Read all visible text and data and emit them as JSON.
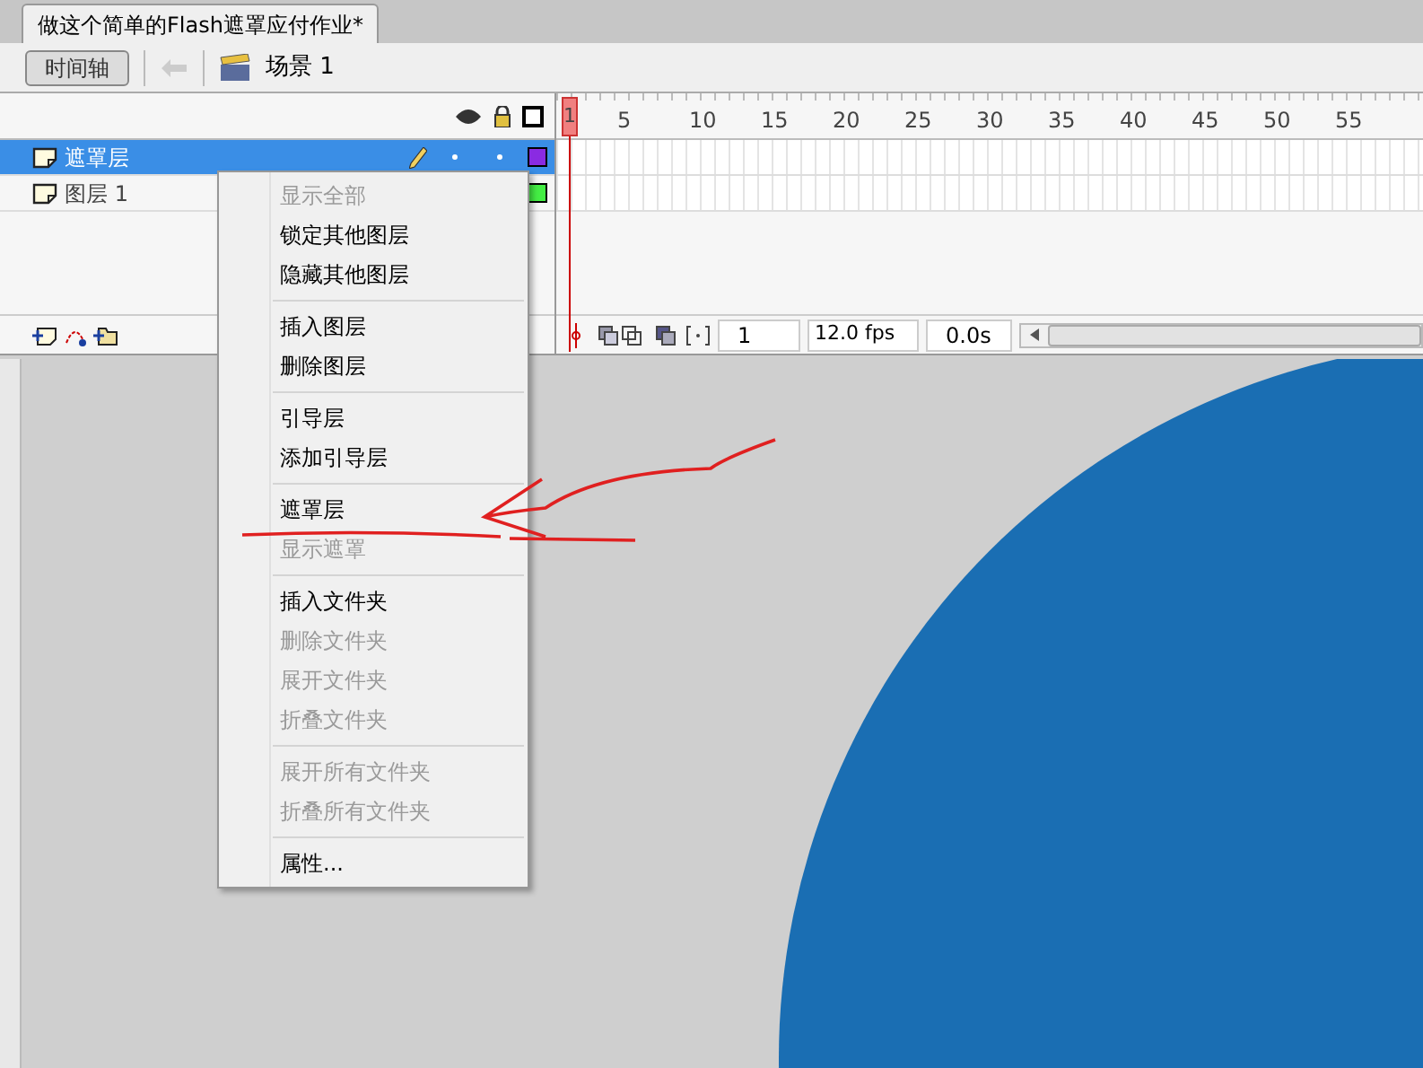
{
  "document_tab": {
    "title": "做这个简单的Flash遮罩应付作业*"
  },
  "toolbar": {
    "timeline_button": "时间轴",
    "scene": "场景 1"
  },
  "timeline": {
    "frame_numbers": [
      "1",
      "5",
      "10",
      "15",
      "20",
      "25",
      "30",
      "35",
      "40",
      "45",
      "50",
      "55"
    ],
    "layers": [
      {
        "name": "遮罩层",
        "selected": true,
        "color": "#8a2be2"
      },
      {
        "name": "图层 1",
        "selected": false,
        "color": "#44ee44"
      }
    ],
    "current_frame": "1",
    "frame_rate": "12.0 fps",
    "elapsed_time": "0.0s"
  },
  "context_menu": [
    {
      "kind": "item",
      "label": "显示全部",
      "disabled": true
    },
    {
      "kind": "item",
      "label": "锁定其他图层",
      "disabled": false
    },
    {
      "kind": "item",
      "label": "隐藏其他图层",
      "disabled": false
    },
    {
      "kind": "separator"
    },
    {
      "kind": "item",
      "label": "插入图层",
      "disabled": false
    },
    {
      "kind": "item",
      "label": "删除图层",
      "disabled": false
    },
    {
      "kind": "separator"
    },
    {
      "kind": "item",
      "label": "引导层",
      "disabled": false
    },
    {
      "kind": "item",
      "label": "添加引导层",
      "disabled": false
    },
    {
      "kind": "separator"
    },
    {
      "kind": "item",
      "label": "遮罩层",
      "disabled": false
    },
    {
      "kind": "item",
      "label": "显示遮罩",
      "disabled": true
    },
    {
      "kind": "separator"
    },
    {
      "kind": "item",
      "label": "插入文件夹",
      "disabled": false
    },
    {
      "kind": "item",
      "label": "删除文件夹",
      "disabled": true
    },
    {
      "kind": "item",
      "label": "展开文件夹",
      "disabled": true
    },
    {
      "kind": "item",
      "label": "折叠文件夹",
      "disabled": true
    },
    {
      "kind": "separator"
    },
    {
      "kind": "item",
      "label": "展开所有文件夹",
      "disabled": true
    },
    {
      "kind": "item",
      "label": "折叠所有文件夹",
      "disabled": true
    },
    {
      "kind": "separator"
    },
    {
      "kind": "item",
      "label": "属性...",
      "disabled": false
    }
  ]
}
